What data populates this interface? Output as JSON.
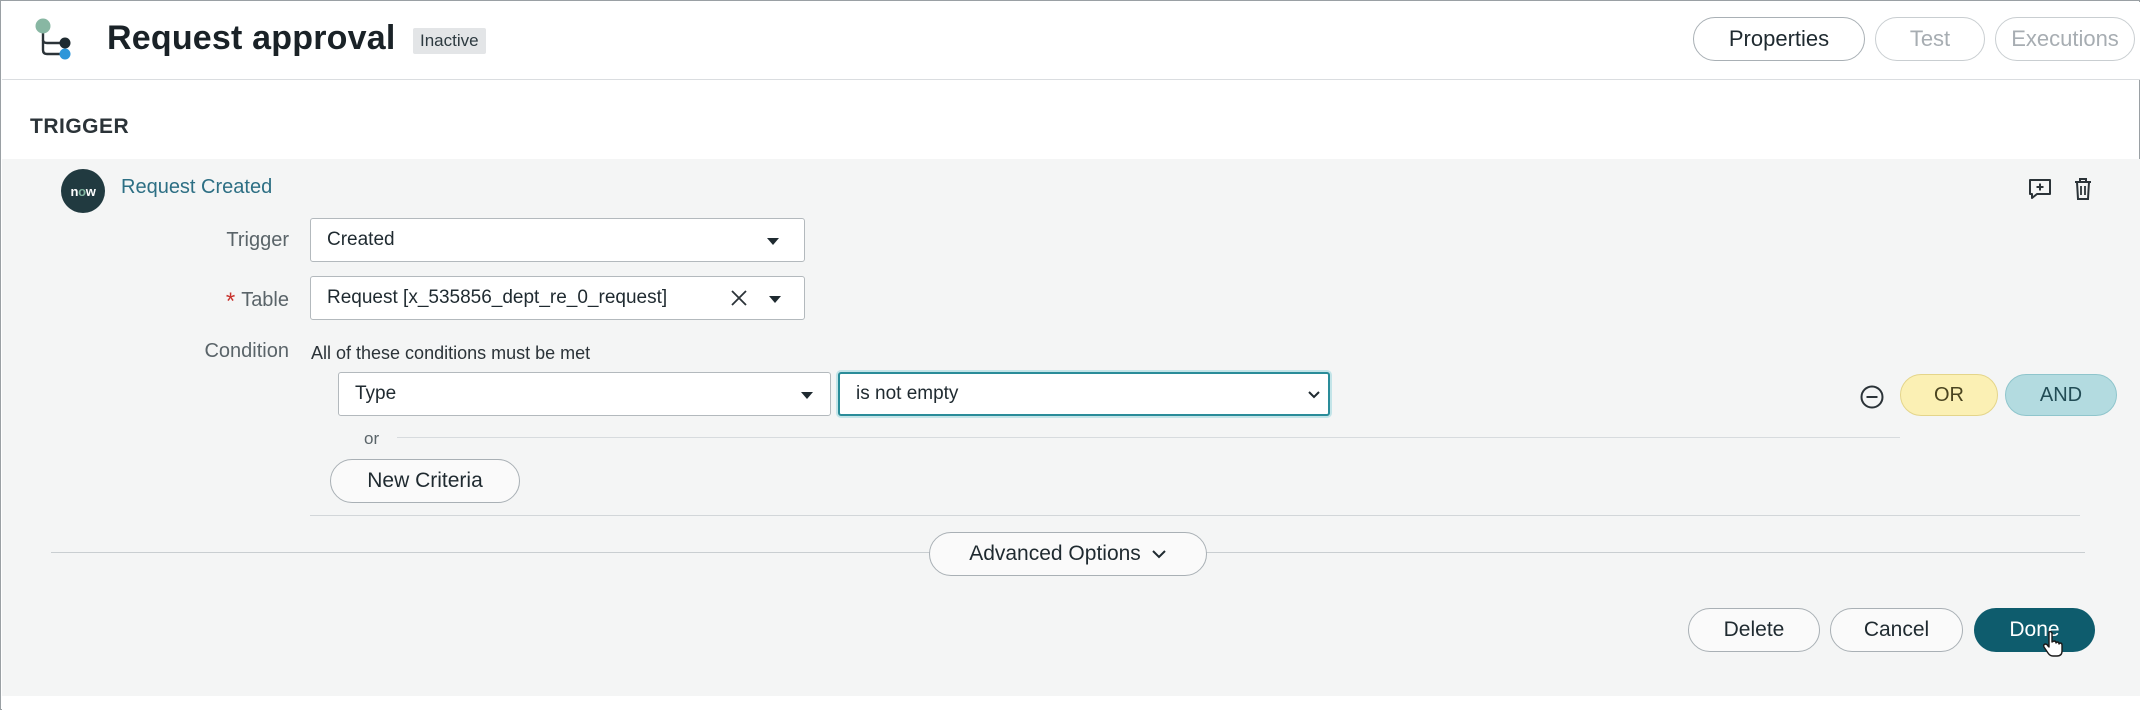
{
  "header": {
    "title": "Request approval",
    "status": "Inactive",
    "buttons": {
      "properties": "Properties",
      "test": "Test",
      "executions": "Executions"
    }
  },
  "section": {
    "label": "TRIGGER"
  },
  "trigger": {
    "logo_text": "now",
    "name": "Request Created",
    "fields": {
      "trigger_label": "Trigger",
      "trigger_value": "Created",
      "table_label": "Table",
      "table_value": "Request [x_535856_dept_re_0_request]",
      "condition_label": "Condition"
    },
    "condition": {
      "description": "All of these conditions must be met",
      "field": "Type",
      "operator": "is not empty",
      "or_separator": "or",
      "new_criteria": "New Criteria",
      "or_button": "OR",
      "and_button": "AND"
    },
    "advanced_options": "Advanced Options",
    "actions": {
      "delete": "Delete",
      "cancel": "Cancel",
      "done": "Done"
    }
  },
  "colors": {
    "link": "#2d6f84",
    "done": "#0e5c6d",
    "or": "#fbf0b4",
    "and": "#b3dbe0",
    "required": "#c8342e"
  },
  "icons": [
    "flow-icon",
    "annotation-icon",
    "trash-icon",
    "clear-icon",
    "caret-down-icon",
    "remove-condition-icon",
    "chevron-down-icon",
    "cursor-icon"
  ]
}
